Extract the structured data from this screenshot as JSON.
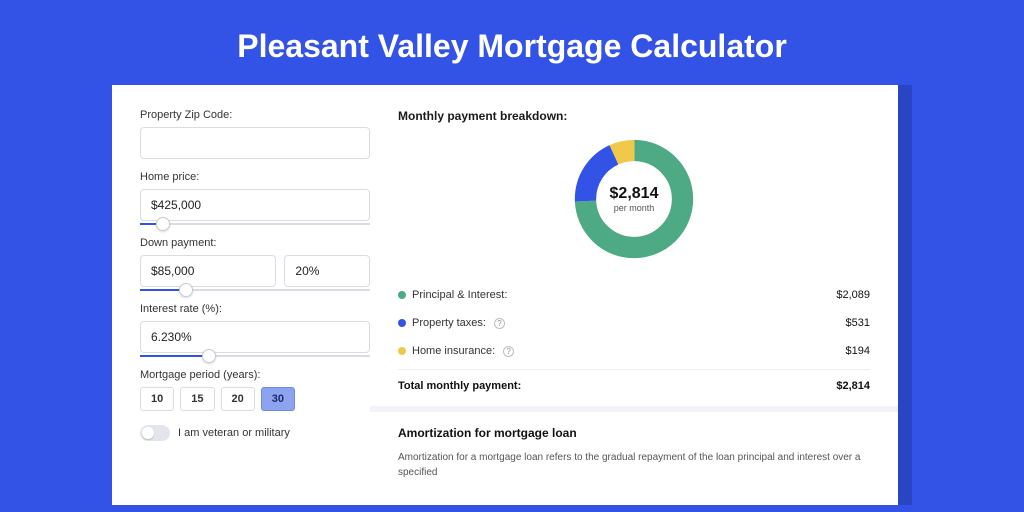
{
  "header": {
    "title": "Pleasant Valley Mortgage Calculator"
  },
  "form": {
    "zip": {
      "label": "Property Zip Code:",
      "value": ""
    },
    "home_price": {
      "label": "Home price:",
      "value": "$425,000",
      "slider_pct": 10
    },
    "down_payment": {
      "label": "Down payment:",
      "value": "$85,000",
      "pct_value": "20%",
      "slider_pct": 20
    },
    "interest": {
      "label": "Interest rate (%):",
      "value": "6.230%",
      "slider_pct": 30
    },
    "period": {
      "label": "Mortgage period (years):",
      "options": [
        "10",
        "15",
        "20",
        "30"
      ],
      "selected_index": 3
    },
    "veteran": {
      "label": "I am veteran or military",
      "checked": false
    }
  },
  "chart_data": {
    "type": "pie",
    "title": "Monthly payment breakdown:",
    "categories": [
      "Principal & Interest",
      "Property taxes",
      "Home insurance"
    ],
    "values": [
      2089,
      531,
      194
    ],
    "colors": [
      "#4ea985",
      "#3253e6",
      "#f0c94b"
    ],
    "total_label": "Total monthly payment:",
    "total_value": "$2,814",
    "center_value": "$2,814",
    "center_sub": "per month",
    "legend": [
      {
        "label": "Principal & Interest:",
        "value": "$2,089",
        "has_info": false
      },
      {
        "label": "Property taxes:",
        "value": "$531",
        "has_info": true
      },
      {
        "label": "Home insurance:",
        "value": "$194",
        "has_info": true
      }
    ]
  },
  "amortization": {
    "title": "Amortization for mortgage loan",
    "body": "Amortization for a mortgage loan refers to the gradual repayment of the loan principal and interest over a specified"
  }
}
